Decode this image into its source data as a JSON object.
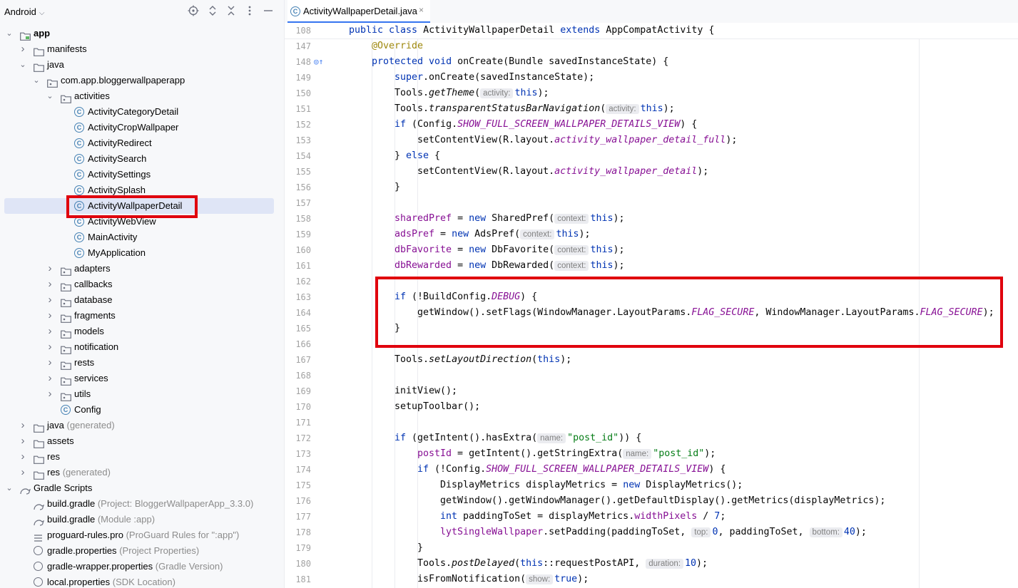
{
  "project_panel": {
    "title": "Android",
    "tree": [
      {
        "label": "app",
        "depth": 0,
        "twisty": "down",
        "icon": "module-folder-icon",
        "bold": true
      },
      {
        "label": "manifests",
        "depth": 1,
        "twisty": "right",
        "icon": "folder-icon"
      },
      {
        "label": "java",
        "depth": 1,
        "twisty": "down",
        "icon": "folder-icon"
      },
      {
        "label": "com.app.bloggerwallpaperapp",
        "depth": 2,
        "twisty": "down",
        "icon": "package-icon"
      },
      {
        "label": "activities",
        "depth": 3,
        "twisty": "down",
        "icon": "package-icon"
      },
      {
        "label": "ActivityCategoryDetail",
        "depth": 4,
        "twisty": "",
        "icon": "class-icon"
      },
      {
        "label": "ActivityCropWallpaper",
        "depth": 4,
        "twisty": "",
        "icon": "class-icon"
      },
      {
        "label": "ActivityRedirect",
        "depth": 4,
        "twisty": "",
        "icon": "class-icon"
      },
      {
        "label": "ActivitySearch",
        "depth": 4,
        "twisty": "",
        "icon": "class-icon"
      },
      {
        "label": "ActivitySettings",
        "depth": 4,
        "twisty": "",
        "icon": "class-icon"
      },
      {
        "label": "ActivitySplash",
        "depth": 4,
        "twisty": "",
        "icon": "class-icon"
      },
      {
        "label": "ActivityWallpaperDetail",
        "depth": 4,
        "twisty": "",
        "icon": "class-icon",
        "selected": true
      },
      {
        "label": "ActivityWebView",
        "depth": 4,
        "twisty": "",
        "icon": "class-icon"
      },
      {
        "label": "MainActivity",
        "depth": 4,
        "twisty": "",
        "icon": "class-icon"
      },
      {
        "label": "MyApplication",
        "depth": 4,
        "twisty": "",
        "icon": "class-icon"
      },
      {
        "label": "adapters",
        "depth": 3,
        "twisty": "right",
        "icon": "package-icon"
      },
      {
        "label": "callbacks",
        "depth": 3,
        "twisty": "right",
        "icon": "package-icon"
      },
      {
        "label": "database",
        "depth": 3,
        "twisty": "right",
        "icon": "package-icon"
      },
      {
        "label": "fragments",
        "depth": 3,
        "twisty": "right",
        "icon": "package-icon"
      },
      {
        "label": "models",
        "depth": 3,
        "twisty": "right",
        "icon": "package-icon"
      },
      {
        "label": "notification",
        "depth": 3,
        "twisty": "right",
        "icon": "package-icon"
      },
      {
        "label": "rests",
        "depth": 3,
        "twisty": "right",
        "icon": "package-icon"
      },
      {
        "label": "services",
        "depth": 3,
        "twisty": "right",
        "icon": "package-icon"
      },
      {
        "label": "utils",
        "depth": 3,
        "twisty": "right",
        "icon": "package-icon"
      },
      {
        "label": "Config",
        "depth": 3,
        "twisty": "",
        "icon": "class-icon"
      },
      {
        "label": "java",
        "hint": "(generated)",
        "depth": 1,
        "twisty": "right",
        "icon": "folder-icon"
      },
      {
        "label": "assets",
        "depth": 1,
        "twisty": "right",
        "icon": "folder-icon"
      },
      {
        "label": "res",
        "depth": 1,
        "twisty": "right",
        "icon": "folder-icon"
      },
      {
        "label": "res",
        "hint": "(generated)",
        "depth": 1,
        "twisty": "right",
        "icon": "folder-icon"
      },
      {
        "label": "Gradle Scripts",
        "depth": 0,
        "twisty": "down",
        "icon": "gradle-icon"
      },
      {
        "label": "build.gradle",
        "hint": "(Project: BloggerWallpaperApp_3.3.0)",
        "depth": 1,
        "twisty": "",
        "icon": "gradle-icon"
      },
      {
        "label": "build.gradle",
        "hint": "(Module :app)",
        "depth": 1,
        "twisty": "",
        "icon": "gradle-icon"
      },
      {
        "label": "proguard-rules.pro",
        "hint": "(ProGuard Rules for \":app\")",
        "depth": 1,
        "twisty": "",
        "icon": "lines-icon"
      },
      {
        "label": "gradle.properties",
        "hint": "(Project Properties)",
        "depth": 1,
        "twisty": "",
        "icon": "gear-icon"
      },
      {
        "label": "gradle-wrapper.properties",
        "hint": "(Gradle Version)",
        "depth": 1,
        "twisty": "",
        "icon": "gear-icon"
      },
      {
        "label": "local.properties",
        "hint": "(SDK Location)",
        "depth": 1,
        "twisty": "",
        "icon": "gear-icon"
      }
    ]
  },
  "editor": {
    "tab_label": "ActivityWallpaperDetail.java",
    "tab_close": "×",
    "lines": [
      {
        "n": "108",
        "indent": 0,
        "sticky": true,
        "t": [
          [
            "kw",
            "public class "
          ],
          [
            "",
            "ActivityWallpaperDetail "
          ],
          [
            "kw",
            "extends "
          ],
          [
            "",
            "AppCompatActivity {"
          ]
        ]
      },
      {
        "n": "147",
        "indent": 1,
        "t": [
          [
            "an",
            "@Override"
          ]
        ]
      },
      {
        "n": "148",
        "indent": 1,
        "mark": "◎↑",
        "t": [
          [
            "kw",
            "protected void "
          ],
          [
            "",
            "onCreate(Bundle savedInstanceState) {"
          ]
        ]
      },
      {
        "n": "149",
        "indent": 2,
        "t": [
          [
            "kw",
            "super"
          ],
          [
            "",
            ".onCreate(savedInstanceState);"
          ]
        ]
      },
      {
        "n": "150",
        "indent": 2,
        "t": [
          [
            "",
            "Tools."
          ],
          [
            "it",
            "getTheme"
          ],
          [
            "",
            "("
          ],
          [
            "hint",
            "activity:"
          ],
          [
            "kw",
            "this"
          ],
          [
            "",
            ");"
          ]
        ]
      },
      {
        "n": "151",
        "indent": 2,
        "t": [
          [
            "",
            "Tools."
          ],
          [
            "it",
            "transparentStatusBarNavigation"
          ],
          [
            "",
            "("
          ],
          [
            "hint",
            "activity:"
          ],
          [
            "kw",
            "this"
          ],
          [
            "",
            ");"
          ]
        ]
      },
      {
        "n": "152",
        "indent": 2,
        "t": [
          [
            "kw",
            "if "
          ],
          [
            "",
            "(Config."
          ],
          [
            "ipv",
            "SHOW_FULL_SCREEN_WALLPAPER_DETAILS_VIEW"
          ],
          [
            "",
            ") {"
          ]
        ]
      },
      {
        "n": "153",
        "indent": 3,
        "t": [
          [
            "",
            "setContentView(R.layout."
          ],
          [
            "ipv",
            "activity_wallpaper_detail_full"
          ],
          [
            "",
            ");"
          ]
        ]
      },
      {
        "n": "154",
        "indent": 2,
        "t": [
          [
            "",
            "} "
          ],
          [
            "kw",
            "else "
          ],
          [
            "",
            "{"
          ]
        ]
      },
      {
        "n": "155",
        "indent": 3,
        "t": [
          [
            "",
            "setContentView(R.layout."
          ],
          [
            "ipv",
            "activity_wallpaper_detail"
          ],
          [
            "",
            ");"
          ]
        ]
      },
      {
        "n": "156",
        "indent": 2,
        "t": [
          [
            "",
            "}"
          ]
        ]
      },
      {
        "n": "157",
        "indent": 0,
        "t": []
      },
      {
        "n": "158",
        "indent": 2,
        "t": [
          [
            "pv",
            "sharedPref"
          ],
          [
            "",
            " = "
          ],
          [
            "kw",
            "new "
          ],
          [
            "",
            "SharedPref("
          ],
          [
            "hint",
            "context:"
          ],
          [
            "kw",
            "this"
          ],
          [
            "",
            ");"
          ]
        ]
      },
      {
        "n": "159",
        "indent": 2,
        "t": [
          [
            "pv",
            "adsPref"
          ],
          [
            "",
            " = "
          ],
          [
            "kw",
            "new "
          ],
          [
            "",
            "AdsPref("
          ],
          [
            "hint",
            "context:"
          ],
          [
            "kw",
            "this"
          ],
          [
            "",
            ");"
          ]
        ]
      },
      {
        "n": "160",
        "indent": 2,
        "t": [
          [
            "pv",
            "dbFavorite"
          ],
          [
            "",
            " = "
          ],
          [
            "kw",
            "new "
          ],
          [
            "",
            "DbFavorite("
          ],
          [
            "hint",
            "context:"
          ],
          [
            "kw",
            "this"
          ],
          [
            "",
            ");"
          ]
        ]
      },
      {
        "n": "161",
        "indent": 2,
        "t": [
          [
            "pv",
            "dbRewarded"
          ],
          [
            "",
            " = "
          ],
          [
            "kw",
            "new "
          ],
          [
            "",
            "DbRewarded("
          ],
          [
            "hint",
            "context:"
          ],
          [
            "kw",
            "this"
          ],
          [
            "",
            ");"
          ]
        ]
      },
      {
        "n": "162",
        "indent": 0,
        "t": []
      },
      {
        "n": "163",
        "indent": 2,
        "t": [
          [
            "kw",
            "if "
          ],
          [
            "",
            "(!BuildConfig."
          ],
          [
            "ipv",
            "DEBUG"
          ],
          [
            "",
            ") {"
          ]
        ]
      },
      {
        "n": "164",
        "indent": 3,
        "t": [
          [
            "",
            "getWindow().setFlags(WindowManager.LayoutParams."
          ],
          [
            "ipv",
            "FLAG_SECURE"
          ],
          [
            "",
            ", WindowManager.LayoutParams."
          ],
          [
            "ipv",
            "FLAG_SECURE"
          ],
          [
            "",
            ");"
          ]
        ]
      },
      {
        "n": "165",
        "indent": 2,
        "t": [
          [
            "",
            "}"
          ]
        ]
      },
      {
        "n": "166",
        "indent": 0,
        "t": []
      },
      {
        "n": "167",
        "indent": 2,
        "t": [
          [
            "",
            "Tools."
          ],
          [
            "it",
            "setLayoutDirection"
          ],
          [
            "",
            "("
          ],
          [
            "kw",
            "this"
          ],
          [
            "",
            ");"
          ]
        ]
      },
      {
        "n": "168",
        "indent": 0,
        "t": []
      },
      {
        "n": "169",
        "indent": 2,
        "t": [
          [
            "",
            "initView();"
          ]
        ]
      },
      {
        "n": "170",
        "indent": 2,
        "t": [
          [
            "",
            "setupToolbar();"
          ]
        ]
      },
      {
        "n": "171",
        "indent": 0,
        "t": []
      },
      {
        "n": "172",
        "indent": 2,
        "t": [
          [
            "kw",
            "if "
          ],
          [
            "",
            "(getIntent().hasExtra("
          ],
          [
            "hint",
            "name:"
          ],
          [
            "st",
            "\"post_id\""
          ],
          [
            "",
            ")) {"
          ]
        ]
      },
      {
        "n": "173",
        "indent": 3,
        "t": [
          [
            "pv",
            "postId"
          ],
          [
            "",
            " = getIntent().getStringExtra("
          ],
          [
            "hint",
            "name:"
          ],
          [
            "st",
            "\"post_id\""
          ],
          [
            "",
            ");"
          ]
        ]
      },
      {
        "n": "174",
        "indent": 3,
        "t": [
          [
            "kw",
            "if "
          ],
          [
            "",
            "(!Config."
          ],
          [
            "ipv",
            "SHOW_FULL_SCREEN_WALLPAPER_DETAILS_VIEW"
          ],
          [
            "",
            ") {"
          ]
        ]
      },
      {
        "n": "175",
        "indent": 4,
        "t": [
          [
            "",
            "DisplayMetrics displayMetrics = "
          ],
          [
            "kw",
            "new "
          ],
          [
            "",
            "DisplayMetrics();"
          ]
        ]
      },
      {
        "n": "176",
        "indent": 4,
        "t": [
          [
            "",
            "getWindow().getWindowManager().getDefaultDisplay().getMetrics(displayMetrics);"
          ]
        ]
      },
      {
        "n": "177",
        "indent": 4,
        "t": [
          [
            "kw",
            "int "
          ],
          [
            "",
            "paddingToSet = displayMetrics."
          ],
          [
            "pv",
            "widthPixels"
          ],
          [
            "",
            " / "
          ],
          [
            "kw",
            "7"
          ],
          [
            "",
            ";"
          ]
        ]
      },
      {
        "n": "178",
        "indent": 4,
        "t": [
          [
            "pv",
            "lytSingleWallpaper"
          ],
          [
            "",
            ".setPadding(paddingToSet, "
          ],
          [
            "hint",
            "top:"
          ],
          [
            "kw",
            "0"
          ],
          [
            "",
            ", paddingToSet, "
          ],
          [
            "hint",
            "bottom:"
          ],
          [
            "kw",
            "40"
          ],
          [
            "",
            ");"
          ]
        ]
      },
      {
        "n": "179",
        "indent": 3,
        "t": [
          [
            "",
            "}"
          ]
        ]
      },
      {
        "n": "180",
        "indent": 3,
        "t": [
          [
            "",
            "Tools."
          ],
          [
            "it",
            "postDelayed"
          ],
          [
            "",
            "("
          ],
          [
            "kw",
            "this"
          ],
          [
            "",
            "::requestPostAPI, "
          ],
          [
            "hint",
            "duration:"
          ],
          [
            "kw",
            "10"
          ],
          [
            "",
            ");"
          ]
        ]
      },
      {
        "n": "181",
        "indent": 3,
        "t": [
          [
            "",
            "isFromNotification("
          ],
          [
            "hint",
            "show:"
          ],
          [
            "kw",
            "true"
          ],
          [
            "",
            ");"
          ]
        ]
      }
    ]
  },
  "colors": {
    "selection_bg": "#dfe5f6",
    "highlight_border": "#e0000d",
    "accent": "#3574f0"
  }
}
